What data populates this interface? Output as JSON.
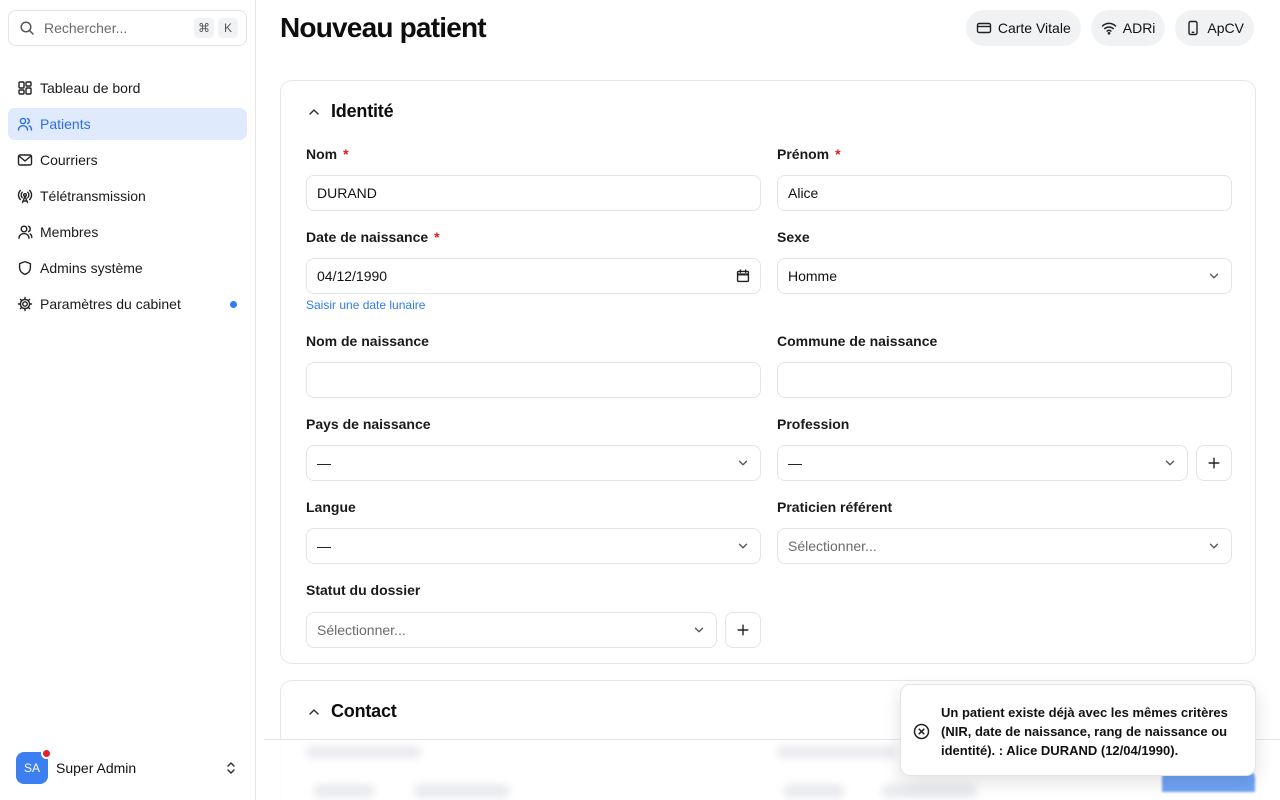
{
  "search": {
    "placeholder": "Rechercher...",
    "kbd_mod": "⌘",
    "kbd_key": "K"
  },
  "sidebar": {
    "items": [
      {
        "label": "Tableau de bord",
        "icon": "dashboard-icon"
      },
      {
        "label": "Patients",
        "icon": "users-icon",
        "active": true
      },
      {
        "label": "Courriers",
        "icon": "mail-icon"
      },
      {
        "label": "Télétransmission",
        "icon": "antenna-icon"
      },
      {
        "label": "Membres",
        "icon": "user-icon"
      },
      {
        "label": "Admins système",
        "icon": "shield-icon"
      },
      {
        "label": "Paramètres du cabinet",
        "icon": "gear-icon",
        "notification_dot": true
      }
    ]
  },
  "user": {
    "initials": "SA",
    "name": "Super Admin"
  },
  "page": {
    "title": "Nouveau patient"
  },
  "actions": {
    "carte_vitale": "Carte Vitale",
    "adri": "ADRi",
    "apcv": "ApCV"
  },
  "identite": {
    "title": "Identité",
    "nom_label": "Nom",
    "nom_value": "DURAND",
    "prenom_label": "Prénom",
    "prenom_value": "Alice",
    "ddn_label": "Date de naissance",
    "ddn_value": "04/12/1990",
    "lunar_link": "Saisir une date lunaire",
    "sexe_label": "Sexe",
    "sexe_value": "Homme",
    "nom_naissance_label": "Nom de naissance",
    "nom_naissance_value": "",
    "commune_label": "Commune de naissance",
    "commune_value": "",
    "pays_label": "Pays de naissance",
    "pays_value": "—",
    "profession_label": "Profession",
    "profession_value": "—",
    "langue_label": "Langue",
    "langue_value": "—",
    "praticien_label": "Praticien référent",
    "praticien_placeholder": "Sélectionner...",
    "statut_label": "Statut du dossier",
    "statut_placeholder": "Sélectionner...",
    "required_mark": "*"
  },
  "contact": {
    "title": "Contact"
  },
  "toast": {
    "message": "Un patient existe déjà avec les mêmes critères (NIR, date de naissance, rang de naissance ou identité). : Alice DURAND (12/04/1990)."
  },
  "colors": {
    "accent": "#2f7bf0",
    "active_bg": "#dfeafc",
    "required": "#d91c1c"
  }
}
